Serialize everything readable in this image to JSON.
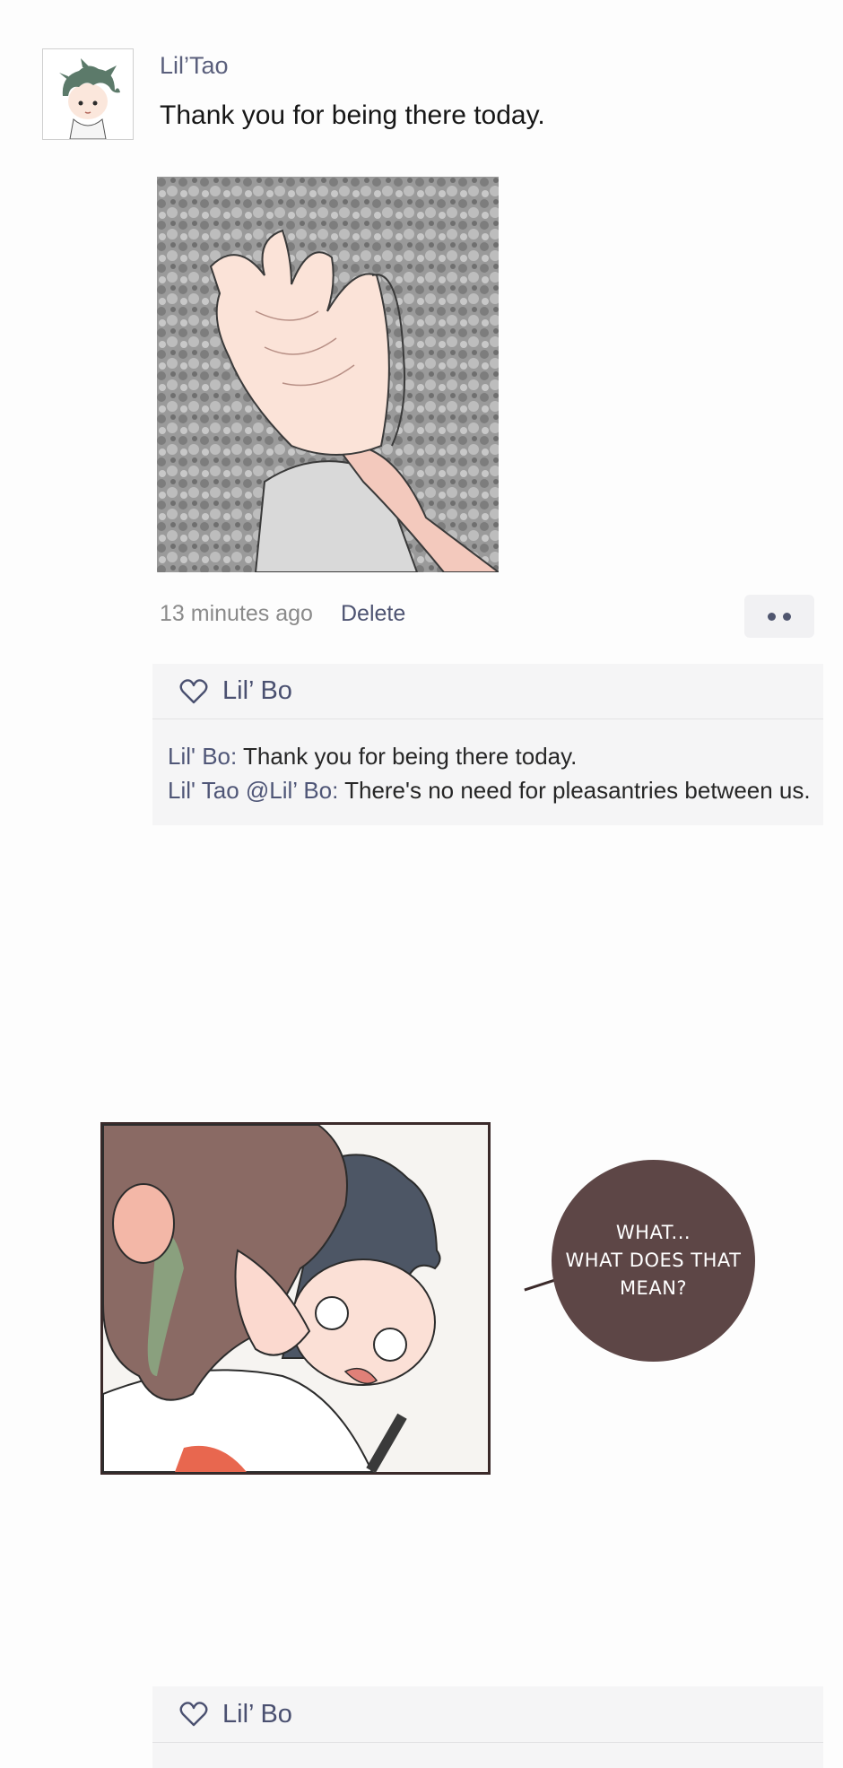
{
  "post": {
    "username": "Lil’Tao",
    "text": "Thank you for being there today.",
    "time": "13 minutes ago",
    "delete_label": "Delete"
  },
  "likes": {
    "name": "Lil’ Bo"
  },
  "comments": [
    {
      "author": "Lil' Bo:",
      "text": " Thank you for being there today."
    },
    {
      "author": "Lil' Tao @Lil’ Bo:",
      "text": " There's no need for pleasantries between us."
    }
  ],
  "comic": {
    "bubble_text": "WHAT...\nWHAT DOES THAT\nMEAN?"
  },
  "likes2": {
    "name": "Lil’ Bo"
  },
  "colors": {
    "accent": "#4f5677",
    "bubble": "#5d4646",
    "panel_border": "#3b2a2a"
  }
}
